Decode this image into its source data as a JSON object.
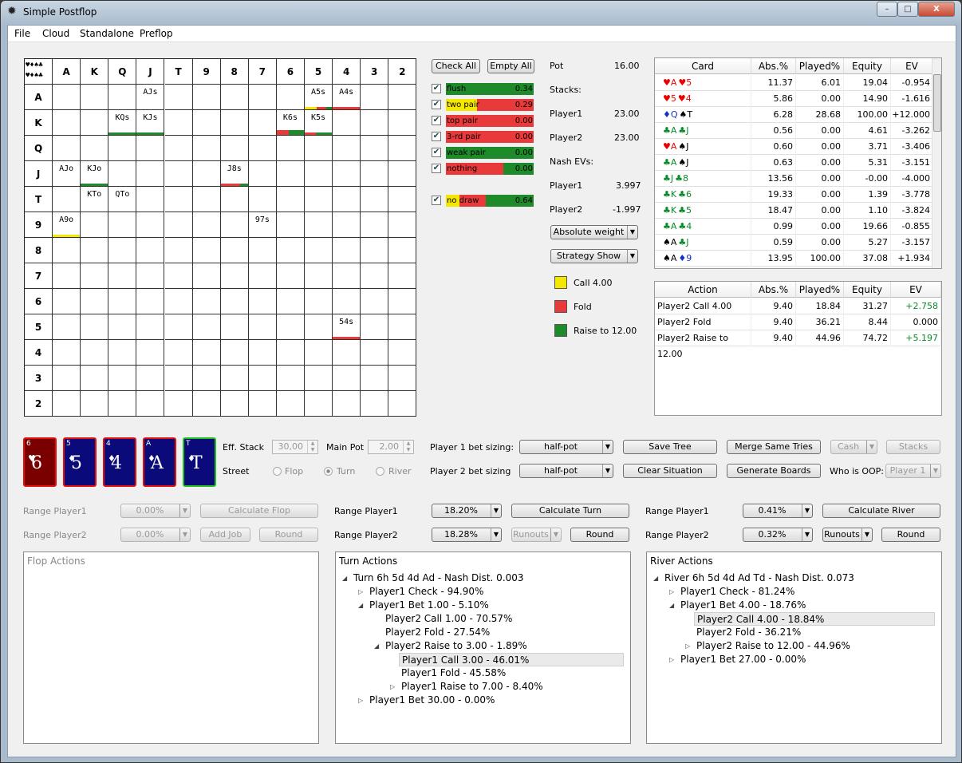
{
  "window": {
    "title": "Simple Postflop",
    "minimize": "–",
    "maximize": "□",
    "close": "X",
    "icon": "gear-icon"
  },
  "menu": [
    "File",
    "Cloud",
    "Standalone",
    "Preflop"
  ],
  "grid": {
    "corner_top": "♥♦♠♣",
    "corner_bottom": "♥♦♠♣",
    "ranks": [
      "A",
      "K",
      "Q",
      "J",
      "T",
      "9",
      "8",
      "7",
      "6",
      "5",
      "4",
      "3",
      "2"
    ],
    "hands": [
      {
        "row": 0,
        "col": 3,
        "label": "AJs",
        "bars": []
      },
      {
        "row": 0,
        "col": 9,
        "label": "A5s",
        "bars": [
          [
            "#f5e800",
            0.45
          ],
          [
            "#e83a3a",
            0.35
          ],
          [
            "#1f8a2a",
            0.2
          ]
        ]
      },
      {
        "row": 0,
        "col": 10,
        "label": "A4s",
        "bars": [
          [
            "#e83a3a",
            1.0
          ]
        ]
      },
      {
        "row": 1,
        "col": 2,
        "label": "KQs",
        "bars": [
          [
            "#1f8a2a",
            1.0
          ]
        ]
      },
      {
        "row": 1,
        "col": 3,
        "label": "KJs",
        "bars": [
          [
            "#1f8a2a",
            1.0
          ]
        ]
      },
      {
        "row": 1,
        "col": 8,
        "label": "K6s",
        "bars": [
          [
            "#e83a3a",
            0.45
          ],
          [
            "#1f8a2a",
            0.55
          ]
        ],
        "tall": true
      },
      {
        "row": 1,
        "col": 9,
        "label": "K5s",
        "bars": [
          [
            "#e83a3a",
            0.4
          ],
          [
            "#1f8a2a",
            0.6
          ]
        ]
      },
      {
        "row": 3,
        "col": 0,
        "label": "AJo",
        "bars": []
      },
      {
        "row": 3,
        "col": 1,
        "label": "KJo",
        "bars": [
          [
            "#1f8a2a",
            1.0
          ]
        ]
      },
      {
        "row": 3,
        "col": 6,
        "label": "J8s",
        "bars": [
          [
            "#e83a3a",
            0.7
          ],
          [
            "#1f8a2a",
            0.3
          ]
        ]
      },
      {
        "row": 4,
        "col": 1,
        "label": "KTo",
        "bars": []
      },
      {
        "row": 4,
        "col": 2,
        "label": "QTo",
        "bars": []
      },
      {
        "row": 5,
        "col": 0,
        "label": "A9o",
        "bars": [
          [
            "#f5e800",
            1.0
          ]
        ]
      },
      {
        "row": 5,
        "col": 7,
        "label": "97s",
        "bars": []
      },
      {
        "row": 9,
        "col": 10,
        "label": "54s",
        "bars": [
          [
            "#e83a3a",
            1.0
          ]
        ]
      }
    ]
  },
  "filters": {
    "check_all": "Check All",
    "empty_all": "Empty All",
    "items": [
      {
        "label": "flush",
        "value": "0.34",
        "yellow": 0.2,
        "green": 1.0
      },
      {
        "label": "two pair",
        "value": "0.29",
        "yellow": 0.35,
        "green": 0.0
      },
      {
        "label": "top pair",
        "value": "0.00",
        "yellow": 0,
        "green": 0
      },
      {
        "label": "3-rd pair",
        "value": "0.00",
        "yellow": 0,
        "green": 0
      },
      {
        "label": "weak pair",
        "value": "0.00",
        "yellow": 0,
        "green": 1.0
      },
      {
        "label": "nothing",
        "value": "0.00",
        "yellow": 0,
        "green": 0.35
      },
      {
        "label": "no draw",
        "value": "0.64",
        "yellow": 0.15,
        "green": 0.55
      }
    ]
  },
  "info": {
    "pot_label": "Pot",
    "pot": "16.00",
    "stacks_label": "Stacks:",
    "p1_label": "Player1",
    "p1_stack": "23.00",
    "p2_label": "Player2",
    "p2_stack": "23.00",
    "nash_label": "Nash EVs:",
    "p1_ev_label": "Player1",
    "p1_ev": "3.997",
    "p2_ev_label": "Player2",
    "p2_ev": "-1.997",
    "weight_select": "Absolute weight",
    "strategy_select": "Strategy Show"
  },
  "legend": [
    {
      "label": "Call 4.00",
      "color": "#f5e800"
    },
    {
      "label": "Fold",
      "color": "#e83a3a"
    },
    {
      "label": "Raise to 12.00",
      "color": "#1f8a2a"
    }
  ],
  "card_table": {
    "headers": [
      "Card",
      "Abs.%",
      "Played%",
      "Equity",
      "EV"
    ],
    "rows": [
      {
        "c1": "♥A",
        "c1c": "red",
        "c2": "♥5",
        "c2c": "red",
        "abs": "11.37",
        "played": "6.01",
        "eq": "19.04",
        "ev": "-0.954"
      },
      {
        "c1": "♥5",
        "c1c": "red",
        "c2": "♥4",
        "c2c": "red",
        "abs": "5.86",
        "played": "0.00",
        "eq": "14.90",
        "ev": "-1.616"
      },
      {
        "c1": "♦Q",
        "c1c": "blu",
        "c2": "♠T",
        "c2c": "blk",
        "abs": "6.28",
        "played": "28.68",
        "eq": "100.00",
        "ev": "+12.000"
      },
      {
        "c1": "♣A",
        "c1c": "grn",
        "c2": "♣J",
        "c2c": "grn",
        "abs": "0.56",
        "played": "0.00",
        "eq": "4.61",
        "ev": "-3.262"
      },
      {
        "c1": "♥A",
        "c1c": "red",
        "c2": "♠J",
        "c2c": "blk",
        "abs": "0.60",
        "played": "0.00",
        "eq": "3.71",
        "ev": "-3.406"
      },
      {
        "c1": "♣A",
        "c1c": "grn",
        "c2": "♠J",
        "c2c": "blk",
        "abs": "0.63",
        "played": "0.00",
        "eq": "5.31",
        "ev": "-3.151"
      },
      {
        "c1": "♣J",
        "c1c": "grn",
        "c2": "♣8",
        "c2c": "grn",
        "abs": "13.56",
        "played": "0.00",
        "eq": "-0.00",
        "ev": "-4.000"
      },
      {
        "c1": "♣K",
        "c1c": "grn",
        "c2": "♣6",
        "c2c": "grn",
        "abs": "19.33",
        "played": "0.00",
        "eq": "1.39",
        "ev": "-3.778"
      },
      {
        "c1": "♣K",
        "c1c": "grn",
        "c2": "♣5",
        "c2c": "grn",
        "abs": "18.47",
        "played": "0.00",
        "eq": "1.10",
        "ev": "-3.824"
      },
      {
        "c1": "♣A",
        "c1c": "grn",
        "c2": "♣4",
        "c2c": "grn",
        "abs": "0.99",
        "played": "0.00",
        "eq": "19.66",
        "ev": "-0.855"
      },
      {
        "c1": "♠A",
        "c1c": "blk",
        "c2": "♣J",
        "c2c": "grn",
        "abs": "0.59",
        "played": "0.00",
        "eq": "5.27",
        "ev": "-3.157"
      },
      {
        "c1": "♠A",
        "c1c": "blk",
        "c2": "♦9",
        "c2c": "blu",
        "abs": "13.95",
        "played": "100.00",
        "eq": "37.08",
        "ev": "+1.934"
      }
    ]
  },
  "action_table": {
    "headers": [
      "Action",
      "Abs.%",
      "Played%",
      "Equity",
      "EV"
    ],
    "rows": [
      {
        "action": "Player2 Call 4.00",
        "abs": "9.40",
        "played": "18.84",
        "eq": "31.27",
        "ev": "+2.758",
        "evc": "grn"
      },
      {
        "action": "Player2 Fold",
        "abs": "9.40",
        "played": "36.21",
        "eq": "8.44",
        "ev": "0.000",
        "evc": "blk"
      },
      {
        "action": "Player2 Raise to 12.00",
        "abs": "9.40",
        "played": "44.96",
        "eq": "74.72",
        "ev": "+5.197",
        "evc": "grn"
      }
    ]
  },
  "board": [
    {
      "rank": "6",
      "suit": "♥",
      "face": "6",
      "bg": "#7a0000",
      "border": "#e01010"
    },
    {
      "rank": "5",
      "suit": "♦",
      "face": "5",
      "bg": "#0a0a7a",
      "border": "#e01010"
    },
    {
      "rank": "4",
      "suit": "♦",
      "face": "4",
      "bg": "#0a0a7a",
      "border": "#e01010"
    },
    {
      "rank": "A",
      "suit": "♦",
      "face": "A",
      "bg": "#0a0a7a",
      "border": "#e01010"
    },
    {
      "rank": "T",
      "suit": "♦",
      "face": "T",
      "bg": "#0a0a7a",
      "border": "#20c020"
    }
  ],
  "settings": {
    "eff_stack_label": "Eff. Stack",
    "eff_stack": "30,00",
    "main_pot_label": "Main Pot",
    "main_pot": "2,00",
    "street_label": "Street",
    "flop": "Flop",
    "turn": "Turn",
    "river": "River",
    "p1_sizing_label": "Player 1 bet sizing:",
    "p1_sizing": "half-pot",
    "p2_sizing_label": "Player 2 bet sizing",
    "p2_sizing": "half-pot",
    "save_tree": "Save Tree",
    "merge": "Merge Same Tries",
    "cash": "Cash",
    "stacks": "Stacks",
    "clear": "Clear Situation",
    "generate": "Generate Boards",
    "oop_label": "Who is OOP:",
    "oop": "Player 1"
  },
  "ranges": {
    "flop": {
      "r1_label": "Range Player1",
      "r1": "0.00%",
      "r2_label": "Range Player2",
      "r2": "0.00%",
      "calc": "Calculate Flop",
      "add_job": "Add Job",
      "round": "Round"
    },
    "turn": {
      "r1_label": "Range Player1",
      "r1": "18.20%",
      "r2_label": "Range Player2",
      "r2": "18.28%",
      "calc": "Calculate Turn",
      "runouts": "Runouts",
      "round": "Round"
    },
    "river": {
      "r1_label": "Range Player1",
      "r1": "0.41%",
      "r2_label": "Range Player2",
      "r2": "0.32%",
      "calc": "Calculate River",
      "runouts": "Runouts",
      "round": "Round"
    }
  },
  "flop_actions": {
    "title": "Flop Actions"
  },
  "turn_actions": {
    "title": "Turn Actions",
    "nodes": [
      {
        "text": "Turn 6h 5d 4d Ad - Nash Dist. 0.003",
        "level": 0,
        "arrow": "open"
      },
      {
        "text": "Player1 Check - 94.90%",
        "level": 1,
        "arrow": "closed"
      },
      {
        "text": "Player1 Bet 1.00 - 5.10%",
        "level": 1,
        "arrow": "open"
      },
      {
        "text": "Player2 Call 1.00 - 70.57%",
        "level": 2,
        "arrow": ""
      },
      {
        "text": "Player2 Fold - 27.54%",
        "level": 2,
        "arrow": ""
      },
      {
        "text": "Player2 Raise to 3.00 - 1.89%",
        "level": 2,
        "arrow": "open"
      },
      {
        "text": "Player1 Call 3.00 - 46.01%",
        "level": 3,
        "arrow": "",
        "selected": true
      },
      {
        "text": "Player1 Fold - 45.58%",
        "level": 3,
        "arrow": ""
      },
      {
        "text": "Player1 Raise to 7.00 - 8.40%",
        "level": 3,
        "arrow": "closed"
      },
      {
        "text": "Player1 Bet 30.00 - 0.00%",
        "level": 1,
        "arrow": "closed"
      }
    ]
  },
  "river_actions": {
    "title": "River Actions",
    "nodes": [
      {
        "text": "River 6h 5d 4d Ad Td - Nash Dist. 0.073",
        "level": 0,
        "arrow": "open"
      },
      {
        "text": "Player1 Check - 81.24%",
        "level": 1,
        "arrow": "closed"
      },
      {
        "text": "Player1 Bet 4.00 - 18.76%",
        "level": 1,
        "arrow": "open"
      },
      {
        "text": "Player2 Call 4.00 - 18.84%",
        "level": 2,
        "arrow": "",
        "selected": true
      },
      {
        "text": "Player2 Fold - 36.21%",
        "level": 2,
        "arrow": ""
      },
      {
        "text": "Player2 Raise to 12.00 - 44.96%",
        "level": 2,
        "arrow": "closed"
      },
      {
        "text": "Player1 Bet 27.00 - 0.00%",
        "level": 1,
        "arrow": "closed"
      }
    ]
  }
}
